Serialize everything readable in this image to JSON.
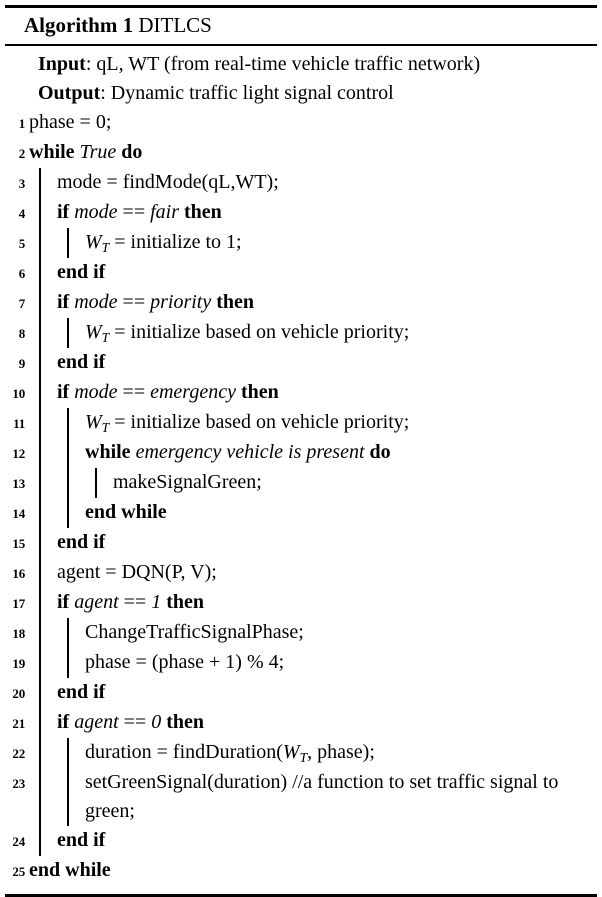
{
  "algorithm": {
    "label": "Algorithm",
    "number": "1",
    "name": "DITLCS",
    "io": {
      "input_label": "Input",
      "input_text": ": qL, WT (from real-time vehicle traffic network)",
      "output_label": "Output",
      "output_text": ": Dynamic traffic light signal control"
    },
    "lines": [
      {
        "n": "1",
        "indent": 0,
        "guides": 0,
        "text": "phase = 0;"
      },
      {
        "n": "2",
        "indent": 0,
        "guides": 0,
        "text": "while True do"
      },
      {
        "n": "3",
        "indent": 1,
        "guides": 1,
        "text": "mode = findMode(qL,WT);"
      },
      {
        "n": "4",
        "indent": 1,
        "guides": 1,
        "text": "if mode == fair then"
      },
      {
        "n": "5",
        "indent": 2,
        "guides": 2,
        "text": "W_T = initialize to 1;"
      },
      {
        "n": "6",
        "indent": 1,
        "guides": 1,
        "text": "end if"
      },
      {
        "n": "7",
        "indent": 1,
        "guides": 1,
        "text": "if mode == priority then"
      },
      {
        "n": "8",
        "indent": 2,
        "guides": 2,
        "text": "W_T = initialize based on vehicle priority;"
      },
      {
        "n": "9",
        "indent": 1,
        "guides": 1,
        "text": "end if"
      },
      {
        "n": "10",
        "indent": 1,
        "guides": 1,
        "text": "if mode == emergency then"
      },
      {
        "n": "11",
        "indent": 2,
        "guides": 2,
        "text": "W_T = initialize based on vehicle priority;"
      },
      {
        "n": "12",
        "indent": 2,
        "guides": 2,
        "text": "while emergency vehicle is present do"
      },
      {
        "n": "13",
        "indent": 3,
        "guides": 3,
        "text": "makeSignalGreen;"
      },
      {
        "n": "14",
        "indent": 2,
        "guides": 2,
        "text": "end while"
      },
      {
        "n": "15",
        "indent": 1,
        "guides": 1,
        "text": "end if"
      },
      {
        "n": "16",
        "indent": 1,
        "guides": 1,
        "text": "agent = DQN(P, V);"
      },
      {
        "n": "17",
        "indent": 1,
        "guides": 1,
        "text": "if agent == 1 then"
      },
      {
        "n": "18",
        "indent": 2,
        "guides": 2,
        "text": "ChangeTrafficSignalPhase;"
      },
      {
        "n": "19",
        "indent": 2,
        "guides": 2,
        "text": "phase = (phase + 1) % 4;"
      },
      {
        "n": "20",
        "indent": 1,
        "guides": 1,
        "text": "end if"
      },
      {
        "n": "21",
        "indent": 1,
        "guides": 1,
        "text": "if agent == 0 then"
      },
      {
        "n": "22",
        "indent": 2,
        "guides": 2,
        "text": "duration = findDuration(W_T, phase);"
      },
      {
        "n": "23",
        "indent": 2,
        "guides": 2,
        "text": "setGreenSignal(duration) //a function to set traffic signal to green;"
      },
      {
        "n": "24",
        "indent": 1,
        "guides": 1,
        "text": "end if"
      },
      {
        "n": "25",
        "indent": 0,
        "guides": 0,
        "text": "end while"
      }
    ]
  }
}
